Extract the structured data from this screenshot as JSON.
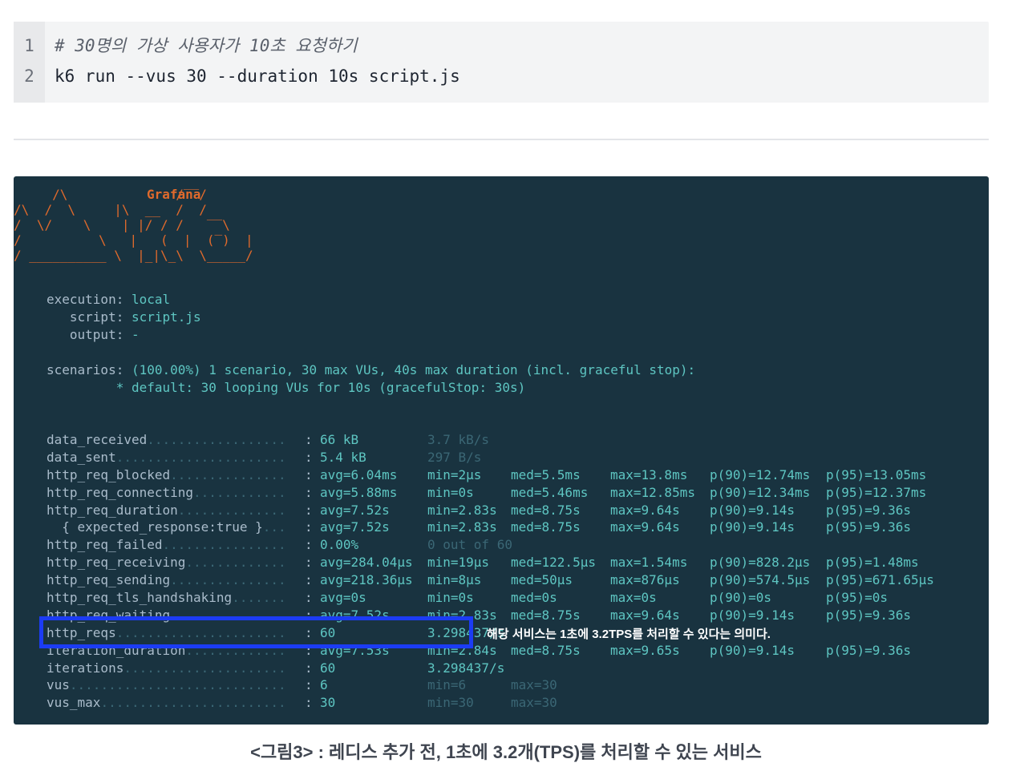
{
  "code_block": {
    "line_numbers": [
      "1",
      "2"
    ],
    "lines": [
      "# 30명의 가상 사용자가 10초 요청하기",
      "k6 run --vus 30 --duration 10s script.js"
    ]
  },
  "terminal": {
    "logo_title": "Grafana",
    "logo_art": "     /\\              /‾‾/  \n/\\  /  \\     |\\  __  /  /   \n/  \\/    \\    | |/ / /   ‾‾\\ \n/          \\   |   (  |  (‾)  |\n/ __________ \\  |_|\\_\\  \\_____/ ",
    "execution": {
      "label": "execution:",
      "value": "local"
    },
    "script": {
      "label": "   script:",
      "value": "script.js"
    },
    "output": {
      "label": "   output:",
      "value": "-"
    },
    "scenarios": {
      "label": "scenarios:",
      "value": "(100.00%) 1 scenario, 30 max VUs, 40s max duration (incl. graceful stop):",
      "detail": "         * default: 30 looping VUs for 10s (gracefulStop: 30s)"
    },
    "metrics": [
      {
        "name": "data_received",
        "dots": "..................",
        "c1": "66 kB",
        "c2": "3.7 kB/s",
        "c2_dim": true
      },
      {
        "name": "data_sent",
        "dots": "......................",
        "c1": "5.4 kB",
        "c2": "297 B/s",
        "c2_dim": true
      },
      {
        "name": "http_req_blocked",
        "dots": "...............",
        "c1": "avg=6.04ms",
        "c2": "min=2µs",
        "c3": "med=5.5ms",
        "c4": "max=13.8ms",
        "c5": "p(90)=12.74ms",
        "c6": "p(95)=13.05ms"
      },
      {
        "name": "http_req_connecting",
        "dots": "............",
        "c1": "avg=5.88ms",
        "c2": "min=0s",
        "c3": "med=5.46ms",
        "c4": "max=12.85ms",
        "c5": "p(90)=12.34ms",
        "c6": "p(95)=12.37ms"
      },
      {
        "name": "http_req_duration",
        "dots": "..............",
        "c1": "avg=7.52s",
        "c2": "min=2.83s",
        "c3": "med=8.75s",
        "c4": "max=9.64s",
        "c5": "p(90)=9.14s",
        "c6": "p(95)=9.36s"
      },
      {
        "name": "  { expected_response:true }",
        "dots": "...",
        "c1": "avg=7.52s",
        "c2": "min=2.83s",
        "c3": "med=8.75s",
        "c4": "max=9.64s",
        "c5": "p(90)=9.14s",
        "c6": "p(95)=9.36s"
      },
      {
        "name": "http_req_failed",
        "dots": "................",
        "c1": "0.00%",
        "c2": "0 out of 60",
        "c2_dim": true
      },
      {
        "name": "http_req_receiving",
        "dots": ".............",
        "c1": "avg=284.04µs",
        "c2": "min=19µs",
        "c3": "med=122.5µs",
        "c4": "max=1.54ms",
        "c5": "p(90)=828.2µs",
        "c6": "p(95)=1.48ms"
      },
      {
        "name": "http_req_sending",
        "dots": "...............",
        "c1": "avg=218.36µs",
        "c2": "min=8µs",
        "c3": "med=50µs",
        "c4": "max=876µs",
        "c5": "p(90)=574.5µs",
        "c6": "p(95)=671.65µs"
      },
      {
        "name": "http_req_tls_handshaking",
        "dots": ".......",
        "c1": "avg=0s",
        "c2": "min=0s",
        "c3": "med=0s",
        "c4": "max=0s",
        "c5": "p(90)=0s",
        "c6": "p(95)=0s"
      },
      {
        "name": "http_req_waiting",
        "dots": "...............",
        "c1": "avg=7.52s",
        "c2": "min=2.83s",
        "c3": "med=8.75s",
        "c4": "max=9.64s",
        "c5": "p(90)=9.14s",
        "c6": "p(95)=9.36s"
      },
      {
        "name": "http_reqs",
        "dots": "......................",
        "c1": "60",
        "c2": "3.298437/s"
      },
      {
        "name": "iteration_duration",
        "dots": ".............",
        "c1": "avg=7.53s",
        "c2": "min=2.84s",
        "c3": "med=8.75s",
        "c4": "max=9.65s",
        "c5": "p(90)=9.14s",
        "c6": "p(95)=9.36s"
      },
      {
        "name": "iterations",
        "dots": ".....................",
        "c1": "60",
        "c2": "3.298437/s"
      },
      {
        "name": "vus",
        "dots": "............................",
        "c1": "6",
        "c2": "min=6",
        "c3": "",
        "c4": "max=30",
        "c2_dim": true,
        "c4_dim": true,
        "c4_at_c3": true
      },
      {
        "name": "vus_max",
        "dots": "........................",
        "c1": "30",
        "c2": "min=30",
        "c3": "",
        "c4": "max=30",
        "c2_dim": true,
        "c4_dim": true,
        "c4_at_c3": true
      }
    ],
    "annotation": "해당 서비스는 1초에 3.2TPS를 처리할 수 있다는 의미다."
  },
  "caption": "<그림3> : 레디스 추가 전, 1초에 3.2개(TPS)를 처리할 수 있는 서비스",
  "colors": {
    "terminal_bg": "#193340",
    "logo_orange": "#e06a2c",
    "value_teal": "#5ec6c2",
    "highlight_blue": "#1c3cf4"
  }
}
